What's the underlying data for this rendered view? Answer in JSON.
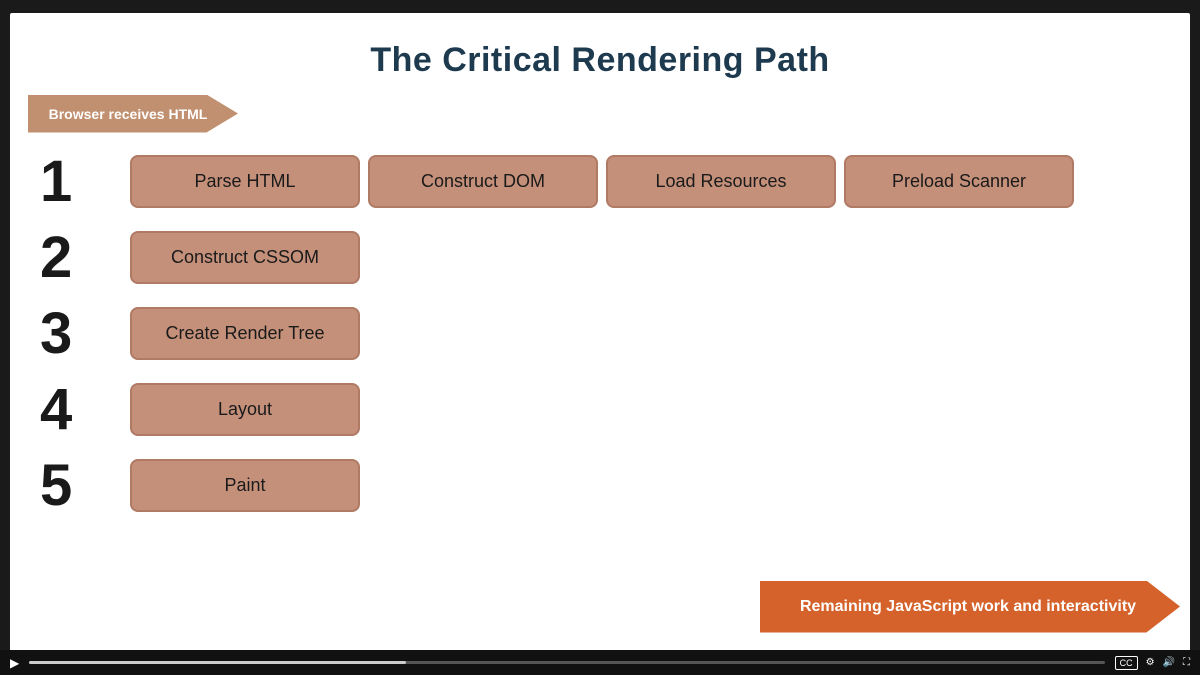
{
  "title": "The Critical Rendering Path",
  "html_arrow": {
    "label": "Browser receives HTML"
  },
  "steps": [
    {
      "number": "1",
      "items": [
        "Parse HTML",
        "Construct DOM",
        "Load Resources",
        "Preload Scanner"
      ]
    },
    {
      "number": "2",
      "items": [
        "Construct CSSOM"
      ]
    },
    {
      "number": "3",
      "items": [
        "Create Render Tree"
      ]
    },
    {
      "number": "4",
      "items": [
        "Layout"
      ]
    },
    {
      "number": "5",
      "items": [
        "Paint"
      ]
    }
  ],
  "bottom_arrow": {
    "label": "Remaining JavaScript work and interactivity"
  },
  "video_bar": {
    "cc": "CC",
    "settings": "⚙",
    "volume": "🔊",
    "fullscreen": "⛶"
  }
}
